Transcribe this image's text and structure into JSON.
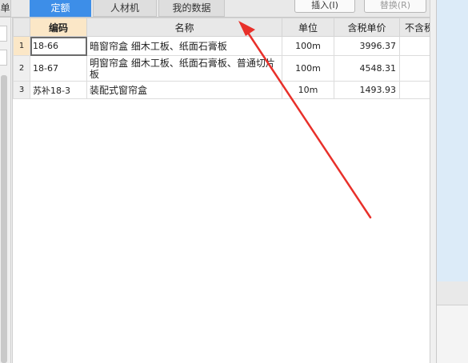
{
  "tabs": {
    "partial_left": "单",
    "quota": "定额",
    "labor_material": "人材机",
    "my_data": "我的数据"
  },
  "toolbar": {
    "insert_label": "插入(I)",
    "replace_label": "替换(R)"
  },
  "table": {
    "headers": {
      "code": "编码",
      "name": "名称",
      "unit": "单位",
      "tax_price": "含税单价",
      "no_tax": "不含税"
    },
    "rows": [
      {
        "index": "1",
        "code": "18-66",
        "name": "暗窗帘盒 细木工板、纸面石膏板",
        "unit": "100m",
        "price": "3996.37"
      },
      {
        "index": "2",
        "code": "18-67",
        "name": "明窗帘盒 细木工板、纸面石膏板、普通切片板",
        "unit": "100m",
        "price": "4548.31"
      },
      {
        "index": "3",
        "code": "苏补18-3",
        "name": "装配式窗帘盒",
        "unit": "10m",
        "price": "1493.93"
      }
    ]
  },
  "colors": {
    "active_tab": "#3d8ee8",
    "selected_header": "#fbe7c7",
    "annotation_arrow": "#e8302a"
  }
}
